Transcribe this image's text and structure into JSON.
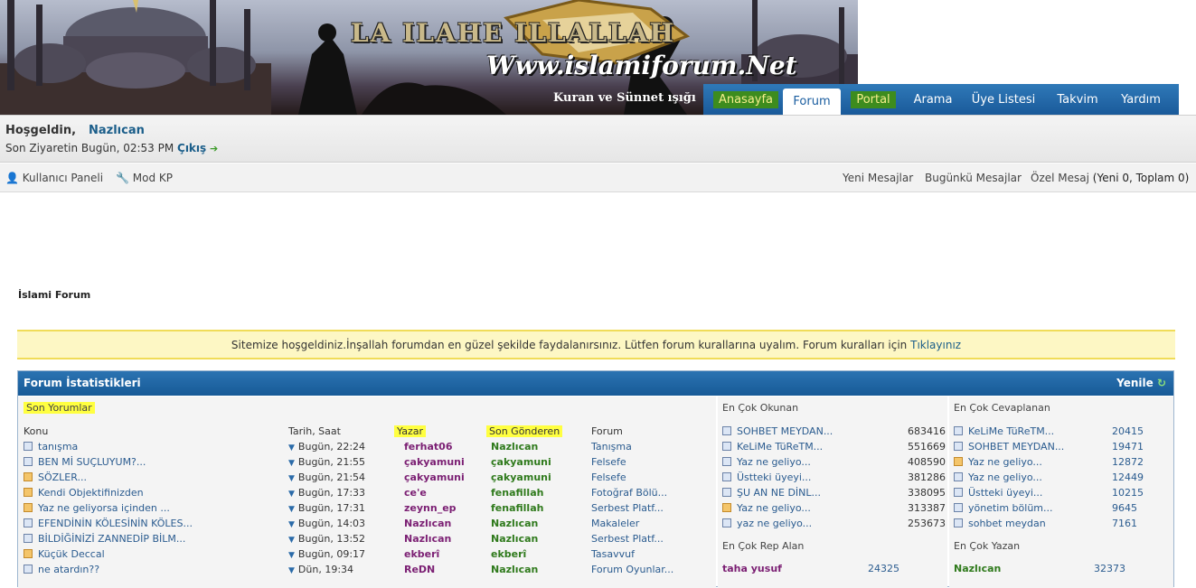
{
  "colors": {
    "nav_blue": "#1a5a9a",
    "accent_green": "#3d8c1e",
    "notice_bg": "#fdf7c4",
    "link": "#1b5e8a",
    "author": "#7b1f73",
    "sender": "#2f7a1c"
  },
  "banner": {
    "title": "LA ILAHE ILLALLAH",
    "url": "Www.islamiforum.Net",
    "slogan": "Kuran ve Sünnet ışığı"
  },
  "nav": [
    {
      "label": "Anasayfa"
    },
    {
      "label": "Forum"
    },
    {
      "label": "Portal"
    },
    {
      "label": "Arama"
    },
    {
      "label": "Üye Listesi"
    },
    {
      "label": "Takvim"
    },
    {
      "label": "Yardım"
    }
  ],
  "welcome": {
    "greeting": "Hoşgeldin,",
    "username": "Nazlıcan",
    "last_visit": "Son Ziyaretin Bugün, 02:53 PM",
    "logout": "Çıkış"
  },
  "toolbar": {
    "user_panel": "Kullanıcı Paneli",
    "mod_panel": "Mod KP",
    "new_posts": "Yeni Mesajlar",
    "today_posts": "Bugünkü Mesajlar",
    "pm_label": "Özel Mesaj",
    "pm_counts": "(Yeni 0, Toplam 0)"
  },
  "breadcrumb": "İslami Forum",
  "notice": {
    "text": "Sitemize hoşgeldiniz.İnşallah forumdan en güzel şekilde faydalanırsınız. Lütfen forum kurallarına uyalım. Forum kuralları için",
    "link": "Tıklayınız"
  },
  "stats": {
    "title": "Forum İstatistikleri",
    "refresh": "Yenile",
    "recent": {
      "title": "Son Yorumlar",
      "headers": {
        "topic": "Konu",
        "date": "Tarih, Saat",
        "author": "Yazar",
        "last_sender": "Son Gönderen",
        "forum": "Forum"
      },
      "rows": [
        {
          "topic": "tanışma",
          "date": "Bugün, 22:24",
          "author": "ferhat06",
          "sender": "Nazlıcan",
          "forum": "Tanışma",
          "hot": false
        },
        {
          "topic": "BEN Mİ SUÇLUYUM?...",
          "date": "Bugün, 21:55",
          "author": "çakyamuni",
          "sender": "çakyamuni",
          "forum": "Felsefe",
          "hot": false
        },
        {
          "topic": "SÖZLER...",
          "date": "Bugün, 21:54",
          "author": "çakyamuni",
          "sender": "çakyamuni",
          "forum": "Felsefe",
          "hot": true
        },
        {
          "topic": "Kendi Objektifinizden",
          "date": "Bugün, 17:33",
          "author": "ce'e",
          "sender": "fenafillah",
          "forum": "Fotoğraf Bölü...",
          "hot": true
        },
        {
          "topic": "Yaz ne geliyorsa içinden ...",
          "date": "Bugün, 17:31",
          "author": "zeynn_ep",
          "sender": "fenafillah",
          "forum": "Serbest Platf...",
          "hot": true
        },
        {
          "topic": "EFENDİNİN KÖLESİNİN KÖLES...",
          "date": "Bugün, 14:03",
          "author": "Nazlıcan",
          "sender": "Nazlıcan",
          "forum": "Makaleler",
          "hot": false
        },
        {
          "topic": "BİLDİĞİNİZİ ZANNEDİP BİLM...",
          "date": "Bugün, 13:52",
          "author": "Nazlıcan",
          "sender": "Nazlıcan",
          "forum": "Serbest Platf...",
          "hot": false
        },
        {
          "topic": "Küçük Deccal",
          "date": "Bugün, 09:17",
          "author": "ekberî",
          "sender": "ekberî",
          "forum": "Tasavvuf",
          "hot": true
        },
        {
          "topic": "ne atardın??",
          "date": "Dün, 19:34",
          "author": "ReDN",
          "sender": "Nazlıcan",
          "forum": "Forum Oyunlar...",
          "hot": false
        }
      ]
    },
    "most_read": {
      "title": "En Çok Okunan",
      "rows": [
        {
          "topic": "SOHBET MEYDAN...",
          "count": "683416",
          "hot": false
        },
        {
          "topic": "KeLiMe TüReTM...",
          "count": "551669",
          "hot": false
        },
        {
          "topic": "Yaz ne geliyo...",
          "count": "408590",
          "hot": false
        },
        {
          "topic": "Üstteki üyeyi...",
          "count": "381286",
          "hot": false
        },
        {
          "topic": "ŞU AN NE DİNL...",
          "count": "338095",
          "hot": false
        },
        {
          "topic": "Yaz ne geliyo...",
          "count": "313387",
          "hot": true
        },
        {
          "topic": "yaz ne geliyo...",
          "count": "253673",
          "hot": false
        }
      ],
      "rep_title": "En Çok Rep Alan",
      "rep_user": "taha yusuf",
      "rep_count": "24325"
    },
    "most_replied": {
      "title": "En Çok Cevaplanan",
      "rows": [
        {
          "topic": "KeLiMe TüReTM...",
          "count": "20415",
          "hot": false
        },
        {
          "topic": "SOHBET MEYDAN...",
          "count": "19471",
          "hot": false
        },
        {
          "topic": "Yaz ne geliyo...",
          "count": "12872",
          "hot": true
        },
        {
          "topic": "Yaz ne geliyo...",
          "count": "12449",
          "hot": false
        },
        {
          "topic": "Üstteki üyeyi...",
          "count": "10215",
          "hot": false
        },
        {
          "topic": "yönetim bölüm...",
          "count": "9645",
          "hot": false
        },
        {
          "topic": "sohbet meydan",
          "count": "7161",
          "hot": false
        }
      ],
      "writer_title": "En Çok Yazan",
      "writer_user": "Nazlıcan",
      "writer_count": "32373"
    }
  }
}
